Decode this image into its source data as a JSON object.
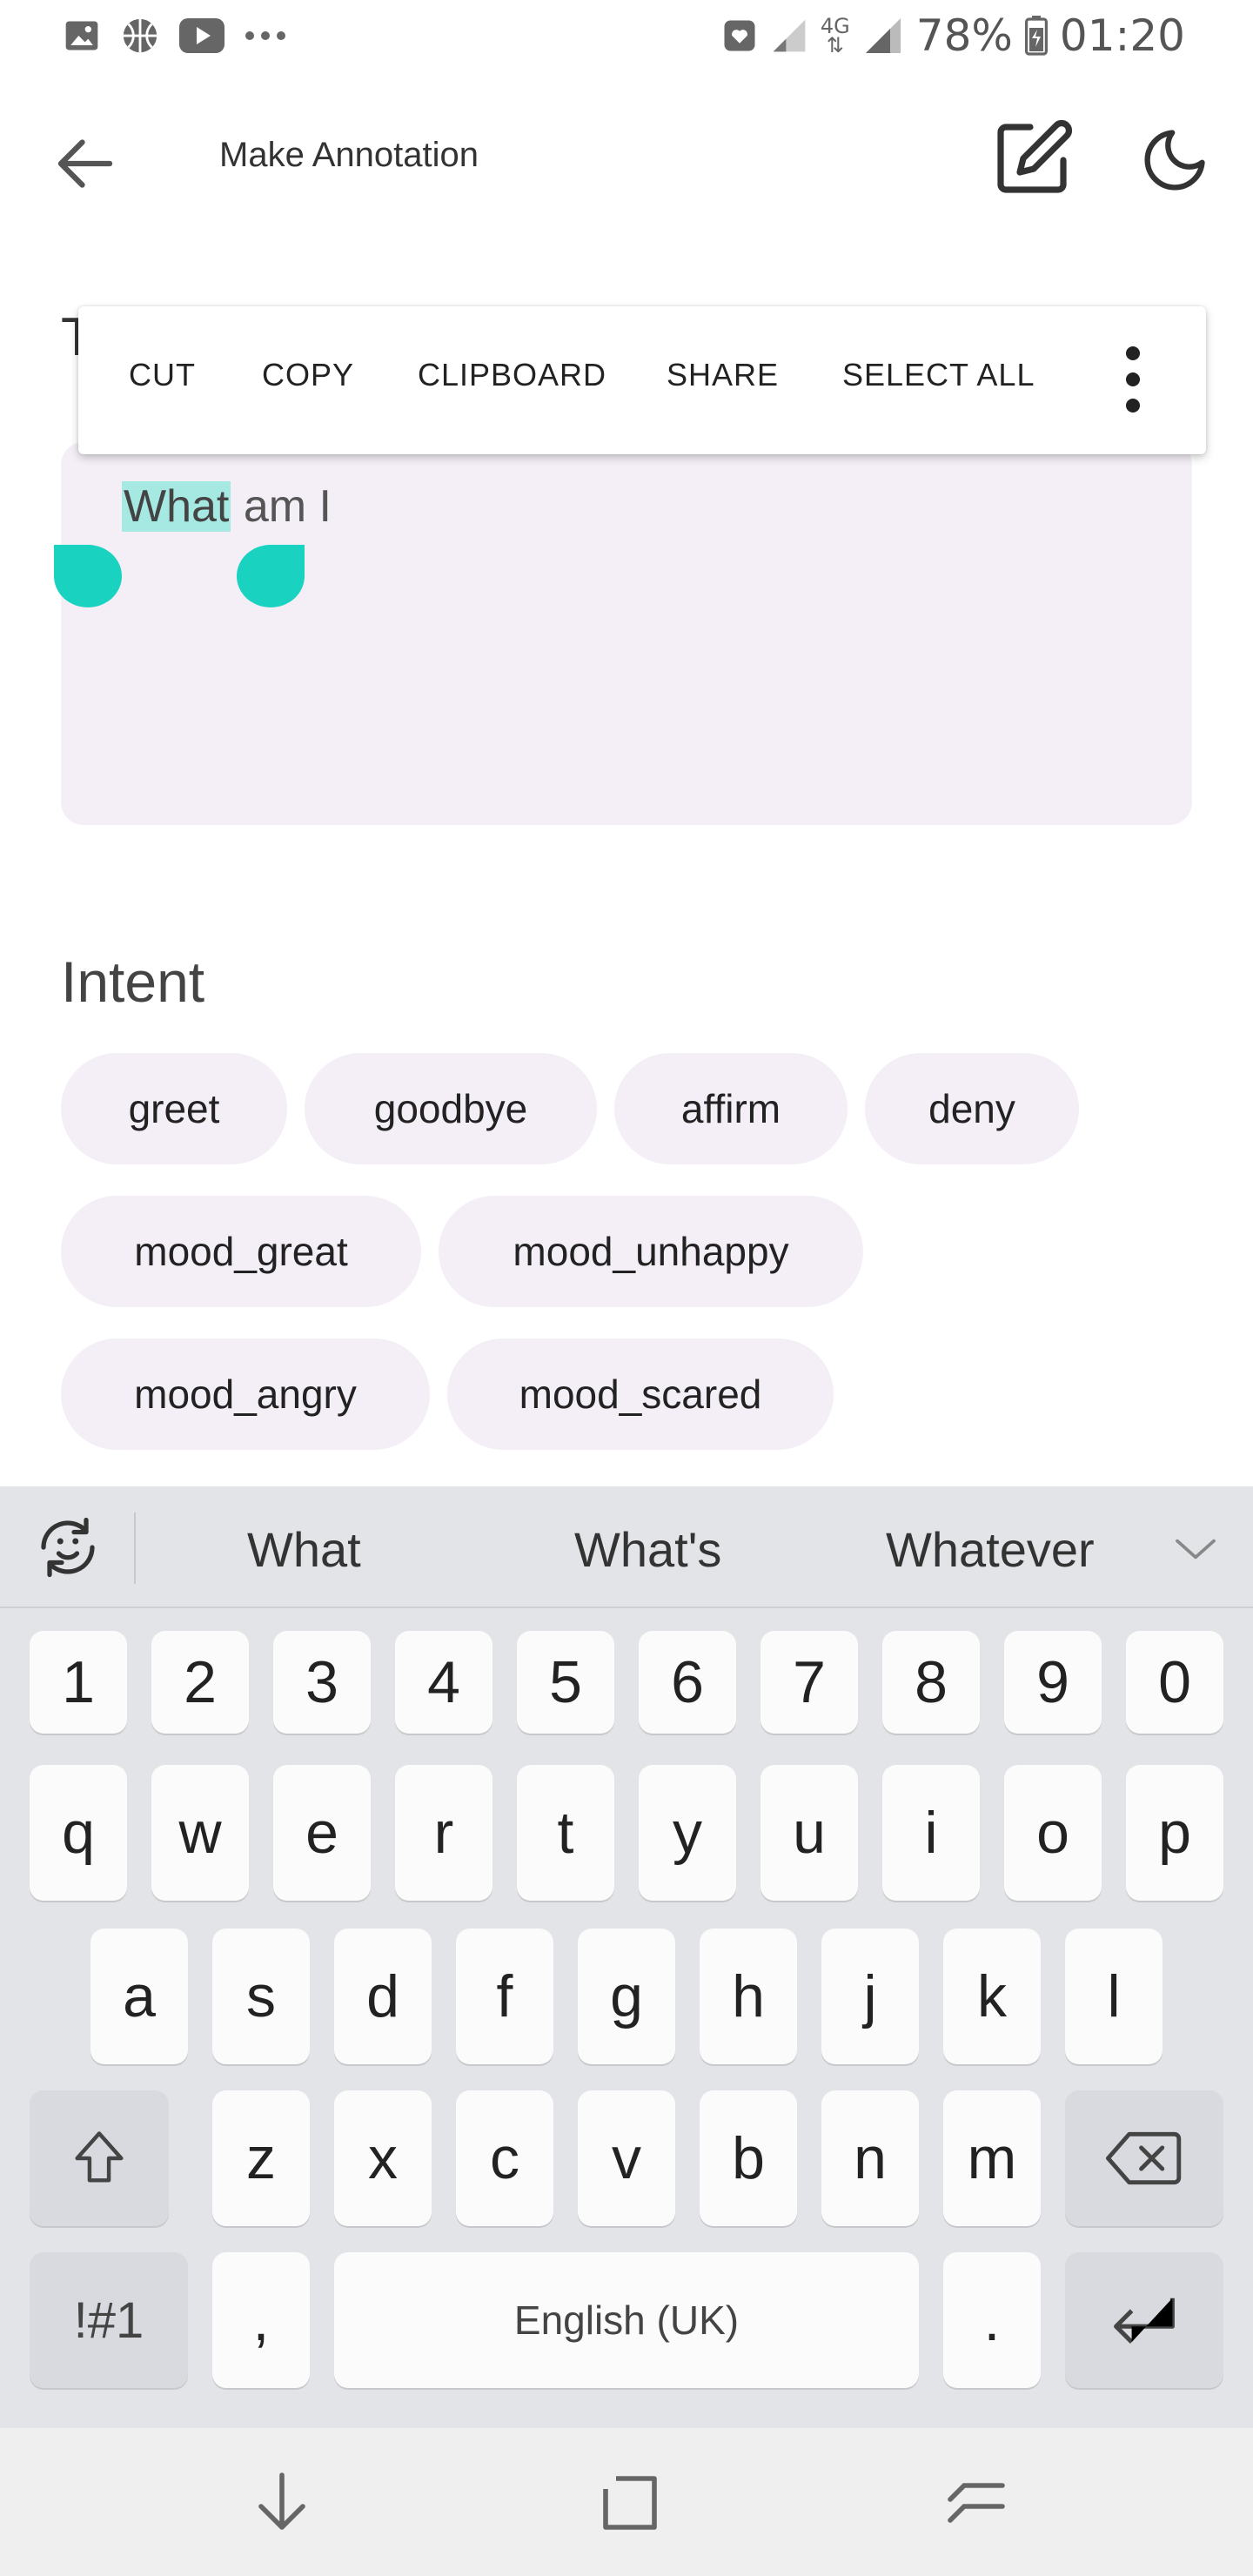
{
  "status_bar": {
    "left_icons": [
      "gallery-icon",
      "basketball-icon",
      "youtube-icon",
      "more-notifications-icon"
    ],
    "right_icons": [
      "heart-message-icon",
      "signal-weak-icon",
      "lte-4g-icon",
      "signal-icon",
      "battery-charging-icon"
    ],
    "network_label": "4G",
    "battery": "78%",
    "time": "01:20"
  },
  "app_bar": {
    "title": "Make Annotation",
    "back_icon": "arrow-back-icon",
    "edit_icon": "edit-icon",
    "theme_icon": "moon-icon"
  },
  "text_section": {
    "heading": "T",
    "text_before": "",
    "selected_text": "What",
    "text_after": " am I"
  },
  "context_menu": {
    "items": [
      "CUT",
      "COPY",
      "CLIPBOARD",
      "SHARE",
      "SELECT ALL"
    ],
    "more_icon": "more-vert-icon"
  },
  "intent": {
    "heading": "Intent",
    "chips": [
      "greet",
      "goodbye",
      "affirm",
      "deny",
      "mood_great",
      "mood_unhappy",
      "mood_angry",
      "mood_scared"
    ]
  },
  "keyboard": {
    "suggestions": [
      "What",
      "What's",
      "Whatever"
    ],
    "emoji_icon": "emoji-sync-icon",
    "expand_icon": "chevron-down-icon",
    "number_row": [
      "1",
      "2",
      "3",
      "4",
      "5",
      "6",
      "7",
      "8",
      "9",
      "0"
    ],
    "row1": [
      "q",
      "w",
      "e",
      "r",
      "t",
      "y",
      "u",
      "i",
      "o",
      "p"
    ],
    "row2": [
      "a",
      "s",
      "d",
      "f",
      "g",
      "h",
      "j",
      "k",
      "l"
    ],
    "row3": [
      "z",
      "x",
      "c",
      "v",
      "b",
      "n",
      "m"
    ],
    "symbols_label": "!#1",
    "comma_label": ",",
    "space_label": "English (UK)",
    "period_label": ".",
    "shift_icon": "shift-icon",
    "backspace_icon": "backspace-icon",
    "enter_icon": "enter-icon"
  },
  "nav_bar": {
    "icons": [
      "hide-keyboard-icon",
      "recents-icon",
      "back-nav-icon"
    ]
  },
  "colors": {
    "selection_handle": "#19d3c0",
    "selection_highlight": "#a6e8e2",
    "field_background": "#f4eff7",
    "keyboard_background": "#e3e4e8"
  }
}
